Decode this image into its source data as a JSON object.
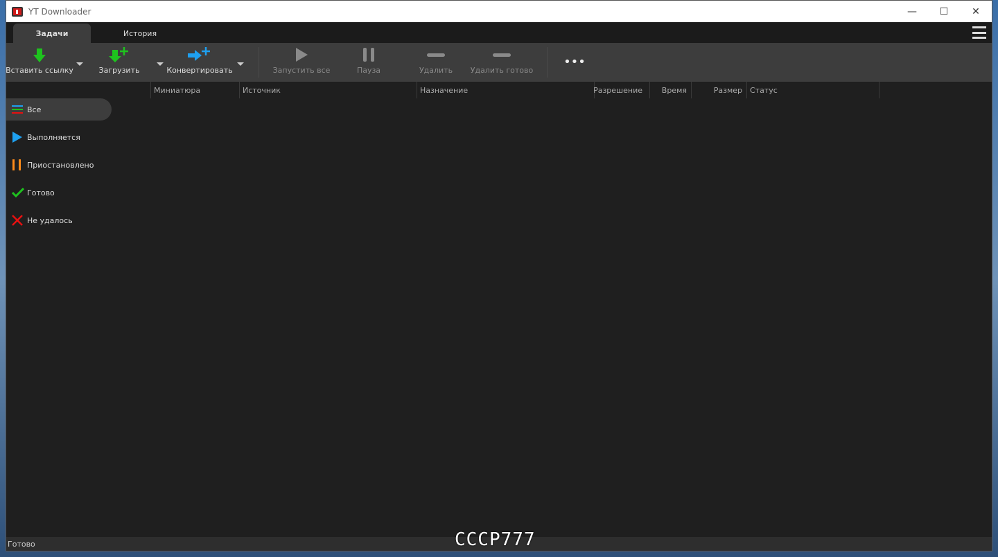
{
  "window": {
    "title": "YT Downloader",
    "minimize": "—",
    "maximize": "☐",
    "close": "✕"
  },
  "tabs": [
    {
      "label": "Задачи"
    },
    {
      "label": "История"
    }
  ],
  "toolbar": {
    "paste": "Вставить ссылку",
    "download": "Загрузить",
    "convert": "Конвертировать",
    "start_all": "Запустить все",
    "pause": "Пауза",
    "delete": "Удалить",
    "delete_done": "Удалить готово",
    "more": "•••"
  },
  "columns": [
    "Миниатюра",
    "Источник",
    "Назначение",
    "Разрешение",
    "Время",
    "Размер",
    "Статус"
  ],
  "sidebar": [
    {
      "label": "Все"
    },
    {
      "label": "Выполняется"
    },
    {
      "label": "Приостановлено"
    },
    {
      "label": "Готово"
    },
    {
      "label": "Не удалось"
    }
  ],
  "status": "Готово",
  "watermark": "CCCP777",
  "colors": {
    "green": "#1ec21e",
    "blue": "#1ea0f0",
    "orange": "#ff8c1a",
    "red": "#e81010"
  }
}
